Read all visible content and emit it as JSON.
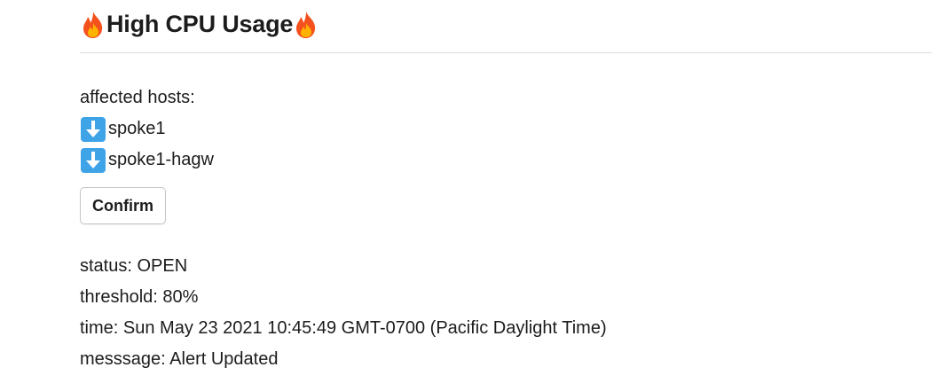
{
  "alert": {
    "title": "High CPU Usage",
    "title_icon": "fire-icon",
    "affected_label": "affected hosts:",
    "hosts": [
      {
        "icon": "down-arrow-icon",
        "name": "spoke1"
      },
      {
        "icon": "down-arrow-icon",
        "name": "spoke1-hagw"
      }
    ],
    "confirm_label": "Confirm",
    "status": "status: OPEN",
    "threshold": "threshold: 80%",
    "time": "time: Sun May 23 2021 10:45:49 GMT-0700 (Pacific Daylight Time)",
    "message": "messsage: Alert Updated"
  },
  "colors": {
    "text": "#1d1c1d",
    "divider": "#dddddd",
    "arrow_box": "#3fa3e8",
    "fire_outer": "#f4511e",
    "fire_inner": "#ffb300"
  }
}
